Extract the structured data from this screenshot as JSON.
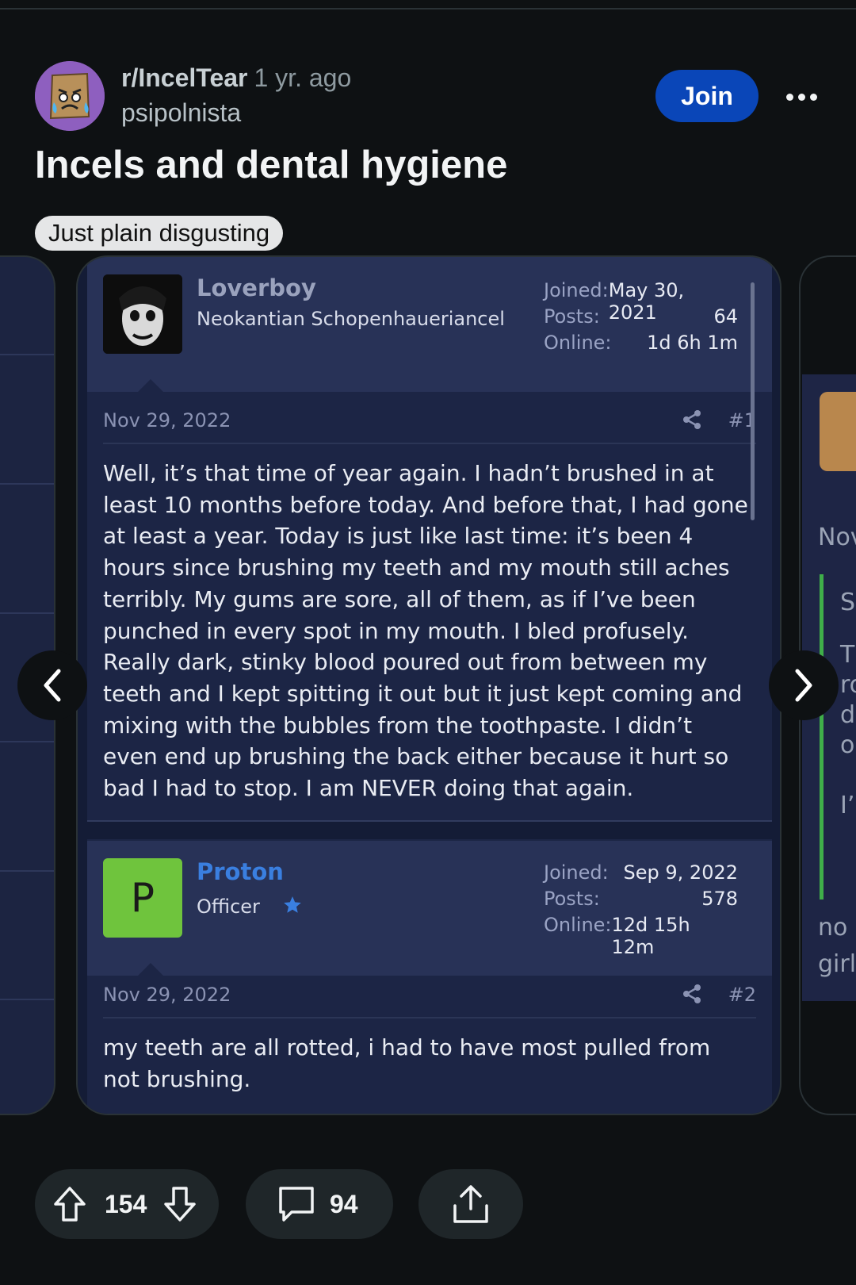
{
  "post": {
    "subreddit": "r/IncelTear",
    "time": "1 yr. ago",
    "author": "psipolnista",
    "join_label": "Join",
    "title": "Incels and dental hygiene",
    "flair": "Just plain disgusting"
  },
  "screenshot": {
    "posts": [
      {
        "user": "Loverboy",
        "user_title": "Neokantian Schopenhaueriancel",
        "user_color": "#9aa2bd",
        "stats": [
          {
            "label": "Joined:",
            "value": "May 30, 2021"
          },
          {
            "label": "Posts:",
            "value": "64"
          },
          {
            "label": "Online:",
            "value": "1d 6h 1m"
          }
        ],
        "date": "Nov 29, 2022",
        "number": "#1",
        "body": "Well, it’s that time of year again. I hadn’t brushed in at least 10 months before today. And before that, I had gone at least a year. Today is just like last time: it’s been 4 hours since brushing my teeth and my mouth still aches terribly. My gums are sore, all of them, as if I’ve been punched in every spot in my mouth. I bled profusely. Really dark, stinky blood poured out from between my teeth and I kept spitting it out but it just kept coming and mixing with the bubbles from the toothpaste. I didn’t even end up brushing the back either because it hurt so bad I had to stop. I am NEVER doing that again."
      },
      {
        "user": "Proton",
        "avatar_letter": "P",
        "user_title": "Officer",
        "user_color": "#3a7fe0",
        "stats": [
          {
            "label": "Joined:",
            "value": "Sep 9, 2022"
          },
          {
            "label": "Posts:",
            "value": "578"
          },
          {
            "label": "Online:",
            "value": "12d 15h 12m"
          }
        ],
        "date": "Nov 29, 2022",
        "number": "#2",
        "body": "my teeth are all rotted, i had to have most pulled from not brushing."
      }
    ],
    "next_card_snippets": [
      "Nov",
      "Sa",
      "Th",
      "ro",
      "d",
      "o",
      "I’n",
      "no",
      "girl"
    ]
  },
  "actions": {
    "upvotes": "154",
    "comments": "94"
  },
  "colors": {
    "background": "#0e1113",
    "join_button": "#0a46b8",
    "card": "#1c2545",
    "card_header": "#283257",
    "officer_star": "#3a7fe0",
    "proton_avatar": "#6fc43d"
  },
  "icons": [
    "sad-paper-bag-avatar-icon",
    "more-dots-icon",
    "share-icon",
    "star-icon",
    "chevron-left-icon",
    "chevron-right-icon",
    "upvote-arrow-icon",
    "downvote-arrow-icon",
    "comment-bubble-icon",
    "share-upload-icon"
  ]
}
